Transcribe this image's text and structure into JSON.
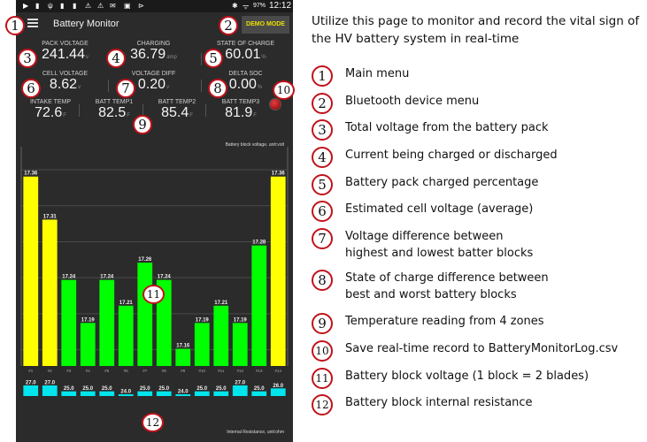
{
  "status_bar": {
    "battery": "97%",
    "time": "12:12"
  },
  "app_bar": {
    "title": "Battery Monitor",
    "demo_mode_label": "DEMO MODE"
  },
  "metrics": {
    "pack_voltage": {
      "label": "PACK VOLTAGE",
      "value": "241.44",
      "unit": "v"
    },
    "charging": {
      "label": "CHARGING",
      "value": "36.79",
      "unit": "amp"
    },
    "state_of_charge": {
      "label": "STATE OF CHARGE",
      "value": "60.01",
      "unit": "%"
    },
    "cell_voltage": {
      "label": "CELL VOLTAGE",
      "value": "8.62",
      "unit": "v"
    },
    "voltage_diff": {
      "label": "VOLTAGE DIFF",
      "value": "0.20",
      "unit": "v"
    },
    "delta_soc": {
      "label": "DELTA SOC",
      "value": "0.00",
      "unit": "%"
    }
  },
  "temps": [
    {
      "label": "INTAKE TEMP",
      "value": "72.6",
      "unit": "F"
    },
    {
      "label": "BATT TEMP1",
      "value": "82.5",
      "unit": "F"
    },
    {
      "label": "BATT TEMP2",
      "value": "85.4",
      "unit": "F"
    },
    {
      "label": "BATT TEMP3",
      "value": "81.9",
      "unit": "F"
    }
  ],
  "chart_data": {
    "type": "bar",
    "title": "Battery block voltage, unit:volt",
    "categories": [
      "#1",
      "#2",
      "#3",
      "#4",
      "#5",
      "#6",
      "#7",
      "#8",
      "#9",
      "#10",
      "#11",
      "#12",
      "#13",
      "#14"
    ],
    "values": [
      17.36,
      17.31,
      17.24,
      17.19,
      17.24,
      17.21,
      17.26,
      17.24,
      17.16,
      17.19,
      17.21,
      17.19,
      17.28,
      17.36
    ],
    "highlight": [
      true,
      true,
      false,
      false,
      false,
      false,
      false,
      false,
      false,
      false,
      false,
      false,
      false,
      true
    ],
    "ylim": [
      17.14,
      17.37
    ],
    "grid": true,
    "colors": {
      "normal": "#00ff00",
      "highlight": "#ffff00"
    },
    "secondary": {
      "type": "bar",
      "title": "Internal Resistance, unit:ohm",
      "values": [
        27.0,
        27.0,
        25.0,
        25.0,
        25.0,
        24.0,
        25.0,
        25.0,
        24.0,
        25.0,
        25.0,
        27.0,
        25.0,
        26.0
      ],
      "ylim": [
        24.0,
        27.0
      ],
      "color": "#00e5ee"
    }
  },
  "markers": [
    "1",
    "2",
    "3",
    "4",
    "5",
    "6",
    "7",
    "8",
    "9",
    "10",
    "11",
    "12"
  ],
  "panel": {
    "intro": "Utilize this page to monitor and record the vital sign of the HV battery system in real-time",
    "annotations": [
      {
        "num": "1",
        "text": "Main menu"
      },
      {
        "num": "2",
        "text": "Bluetooth device menu"
      },
      {
        "num": "3",
        "text": "Total voltage from the battery pack"
      },
      {
        "num": "4",
        "text": "Current being charged or discharged"
      },
      {
        "num": "5",
        "text": "Battery pack charged percentage"
      },
      {
        "num": "6",
        "text": "Estimated cell voltage (average)"
      },
      {
        "num": "7",
        "text": "Voltage difference between\nhighest and lowest batter blocks"
      },
      {
        "num": "8",
        "text": "State of charge difference between\nbest and worst battery blocks"
      },
      {
        "num": "9",
        "text": "Temperature reading from 4 zones"
      },
      {
        "num": "10",
        "text": "Save real-time record to BatteryMonitorLog.csv"
      },
      {
        "num": "11",
        "text": "Battery block voltage (1 block = 2 blades)"
      },
      {
        "num": "12",
        "text": "Battery block internal resistance"
      }
    ]
  }
}
